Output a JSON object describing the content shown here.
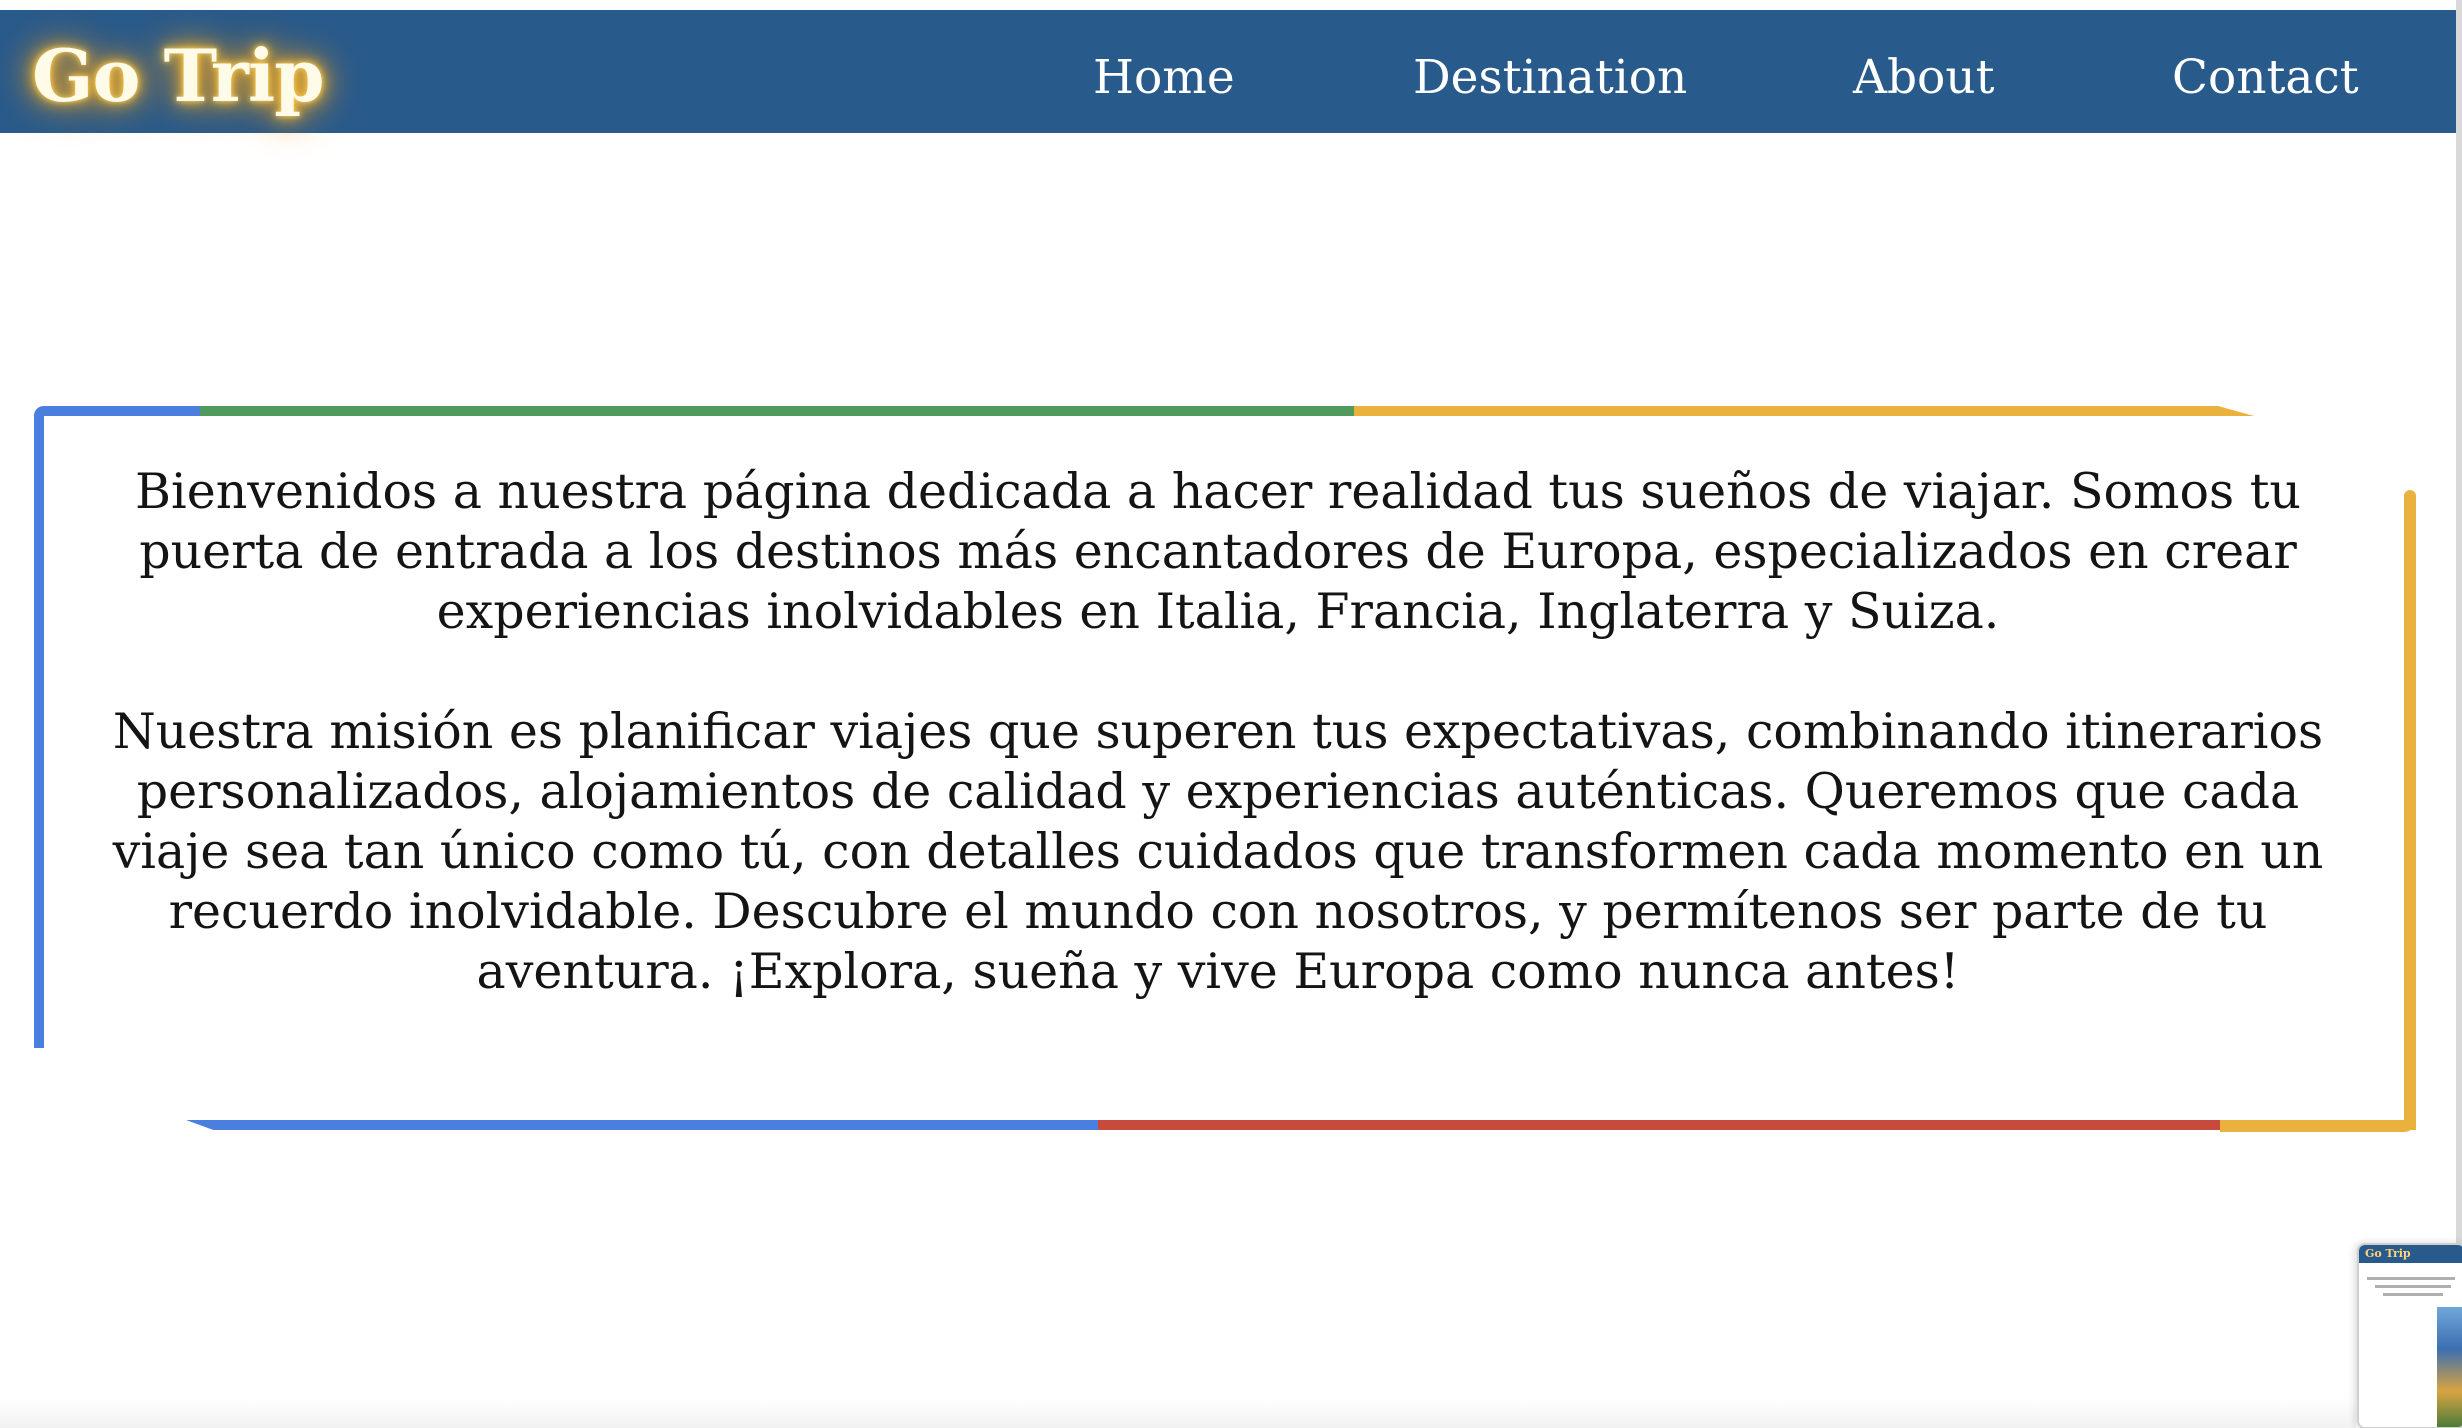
{
  "brand": {
    "logo_text": "Go Trip"
  },
  "nav": {
    "items": [
      {
        "label": "Home"
      },
      {
        "label": "Destination"
      },
      {
        "label": "About"
      },
      {
        "label": "Contact"
      }
    ]
  },
  "welcome": {
    "paragraph_1": "Bienvenidos a nuestra página dedicada a hacer realidad tus sueños de viajar. Somos tu puerta de entrada a los destinos más encantadores de Europa, especializados en crear experiencias inolvidables en Italia, Francia, Inglaterra y Suiza.",
    "paragraph_2": "Nuestra misión es planificar viajes que superen tus expectativas, combinando itinerarios personalizados, alojamientos de calidad y experiencias auténticas. Queremos que cada viaje sea tan único como tú, con detalles cuidados que transformen cada momento en un recuerdo inolvidable. Descubre el mundo con nosotros, y permítenos ser parte de tu aventura. ¡Explora, sueña y vive Europa como nunca antes!"
  },
  "frame_colors": {
    "blue": "#4a7fe0",
    "green": "#4f9a5c",
    "yellow": "#ebb13d",
    "red": "#c84a3c"
  },
  "theme": {
    "navbar_bg": "#285a8c",
    "logo_glow": "#f4a21b"
  },
  "thumbnail": {
    "logo_text": "Go Trip"
  }
}
